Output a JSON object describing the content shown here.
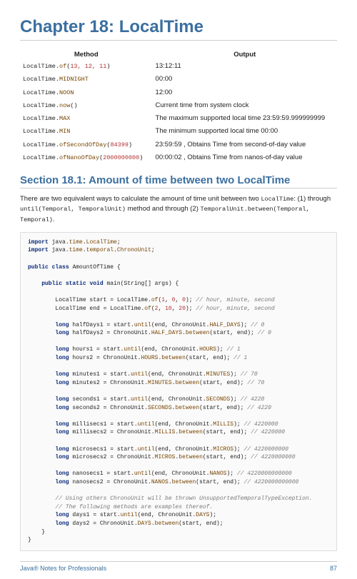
{
  "chapter": {
    "title": "Chapter 18: LocalTime"
  },
  "table": {
    "headers": {
      "col1": "Method",
      "col2": "Output"
    },
    "rows": [
      {
        "m_pre": "LocalTime.",
        "m_fn": "of",
        "m_open": "(",
        "m_args": "13, 12, 11",
        "m_close": ")",
        "out": "13:12:11"
      },
      {
        "m_pre": "LocalTime.",
        "m_fn": "MIDNIGHT",
        "m_open": "",
        "m_args": "",
        "m_close": "",
        "out": "00:00"
      },
      {
        "m_pre": "LocalTime.",
        "m_fn": "NOON",
        "m_open": "",
        "m_args": "",
        "m_close": "",
        "out": "12:00"
      },
      {
        "m_pre": "LocalTime.",
        "m_fn": "now",
        "m_open": "(",
        "m_args": "",
        "m_close": ")",
        "out": "Current time from system clock"
      },
      {
        "m_pre": "LocalTime.",
        "m_fn": "MAX",
        "m_open": "",
        "m_args": "",
        "m_close": "",
        "out": "The maximum supported local time 23:59:59.999999999"
      },
      {
        "m_pre": "LocalTime.",
        "m_fn": "MIN",
        "m_open": "",
        "m_args": "",
        "m_close": "",
        "out": "The minimum supported local time 00:00"
      },
      {
        "m_pre": "LocalTime.",
        "m_fn": "ofSecondOfDay",
        "m_open": "(",
        "m_args": "84399",
        "m_close": ")",
        "out": "23:59:59 , Obtains Time from second-of-day value"
      },
      {
        "m_pre": "LocalTime.",
        "m_fn": "ofNanoOfDay",
        "m_open": "(",
        "m_args": "2000000000",
        "m_close": ")",
        "out": "00:00:02 , Obtains Time from nanos-of-day value"
      }
    ]
  },
  "section": {
    "title": "Section 18.1: Amount of time between two LocalTime"
  },
  "para": {
    "t1": "There are two equivalent ways to calculate the amount of time unit between two ",
    "c1": "LocalTime",
    "t2": ": (1) through ",
    "c2": "until(Temporal, TemporalUnit)",
    "t3": " method and through (2) ",
    "c3": "TemporalUnit.between(Temporal, Temporal)",
    "t4": "."
  },
  "code": {
    "l01a": "import",
    "l01b": " java.",
    "l01c": "time",
    "l01d": ".",
    "l01e": "LocalTime",
    "l01f": ";",
    "l02a": "import",
    "l02b": " java.",
    "l02c": "time",
    "l02d": ".",
    "l02e": "temporal",
    "l02f": ".",
    "l02g": "ChronoUnit",
    "l02h": ";",
    "l03a": "public",
    "l03b": " ",
    "l03c": "class",
    "l03d": " AmountOfTime {",
    "l04a": "    ",
    "l04b": "public",
    "l04c": " ",
    "l04d": "static",
    "l04e": " ",
    "l04f": "void",
    "l04g": " main(String[] args) {",
    "l05a": "        LocalTime start = LocalTime.",
    "l05b": "of",
    "l05c": "(",
    "l05d": "1",
    "l05e": ", ",
    "l05f": "0",
    "l05g": ", ",
    "l05h": "0",
    "l05i": "); ",
    "l05j": "// hour, minute, second",
    "l06a": "        LocalTime end = LocalTime.",
    "l06b": "of",
    "l06c": "(",
    "l06d": "2",
    "l06e": ", ",
    "l06f": "10",
    "l06g": ", ",
    "l06h": "20",
    "l06i": "); ",
    "l06j": "// hour, minute, second",
    "l07a": "        ",
    "l07b": "long",
    "l07c": " halfDays1 = start.",
    "l07d": "until",
    "l07e": "(end, ChronoUnit.",
    "l07f": "HALF_DAYS",
    "l07g": "); ",
    "l07h": "// 0",
    "l08a": "        ",
    "l08b": "long",
    "l08c": " halfDays2 = ChronoUnit.",
    "l08d": "HALF_DAYS",
    "l08e": ".",
    "l08f": "between",
    "l08g": "(start, end); ",
    "l08h": "// 0",
    "l09a": "        ",
    "l09b": "long",
    "l09c": " hours1 = start.",
    "l09d": "until",
    "l09e": "(end, ChronoUnit.",
    "l09f": "HOURS",
    "l09g": "); ",
    "l09h": "// 1",
    "l10a": "        ",
    "l10b": "long",
    "l10c": " hours2 = ChronoUnit.",
    "l10d": "HOURS",
    "l10e": ".",
    "l10f": "between",
    "l10g": "(start, end); ",
    "l10h": "// 1",
    "l11a": "        ",
    "l11b": "long",
    "l11c": " minutes1 = start.",
    "l11d": "until",
    "l11e": "(end, ChronoUnit.",
    "l11f": "MINUTES",
    "l11g": "); ",
    "l11h": "// 70",
    "l12a": "        ",
    "l12b": "long",
    "l12c": " minutes2 = ChronoUnit.",
    "l12d": "MINUTES",
    "l12e": ".",
    "l12f": "between",
    "l12g": "(start, end); ",
    "l12h": "// 70",
    "l13a": "        ",
    "l13b": "long",
    "l13c": " seconds1 = start.",
    "l13d": "until",
    "l13e": "(end, ChronoUnit.",
    "l13f": "SECONDS",
    "l13g": "); ",
    "l13h": "// 4220",
    "l14a": "        ",
    "l14b": "long",
    "l14c": " seconds2 = ChronoUnit.",
    "l14d": "SECONDS",
    "l14e": ".",
    "l14f": "between",
    "l14g": "(start, end); ",
    "l14h": "// 4220",
    "l15a": "        ",
    "l15b": "long",
    "l15c": " millisecs1 = start.",
    "l15d": "until",
    "l15e": "(end, ChronoUnit.",
    "l15f": "MILLIS",
    "l15g": "); ",
    "l15h": "// 4220000",
    "l16a": "        ",
    "l16b": "long",
    "l16c": " millisecs2 = ChronoUnit.",
    "l16d": "MILLIS",
    "l16e": ".",
    "l16f": "between",
    "l16g": "(start, end); ",
    "l16h": "// 4220000",
    "l17a": "        ",
    "l17b": "long",
    "l17c": " microsecs1 = start.",
    "l17d": "until",
    "l17e": "(end, ChronoUnit.",
    "l17f": "MICROS",
    "l17g": "); ",
    "l17h": "// 4220000000",
    "l18a": "        ",
    "l18b": "long",
    "l18c": " microsecs2 = ChronoUnit.",
    "l18d": "MICROS",
    "l18e": ".",
    "l18f": "between",
    "l18g": "(start, end); ",
    "l18h": "// 4220000000",
    "l19a": "        ",
    "l19b": "long",
    "l19c": " nanosecs1 = start.",
    "l19d": "until",
    "l19e": "(end, ChronoUnit.",
    "l19f": "NANOS",
    "l19g": "); ",
    "l19h": "// 4220000000000",
    "l20a": "        ",
    "l20b": "long",
    "l20c": " nanosecs2 = ChronoUnit.",
    "l20d": "NANOS",
    "l20e": ".",
    "l20f": "between",
    "l20g": "(start, end); ",
    "l20h": "// 4220000000000",
    "l21a": "        ",
    "l21b": "// Using others ChronoUnit will be thrown UnsupportedTemporalTypeException.",
    "l22a": "        ",
    "l22b": "// The following methods are examples thereof.",
    "l23a": "        ",
    "l23b": "long",
    "l23c": " days1 = start.",
    "l23d": "until",
    "l23e": "(end, ChronoUnit.",
    "l23f": "DAYS",
    "l23g": ");",
    "l24a": "        ",
    "l24b": "long",
    "l24c": " days2 = ChronoUnit.",
    "l24d": "DAYS",
    "l24e": ".",
    "l24f": "between",
    "l24g": "(start, end);",
    "l25": "    }",
    "l26": "}"
  },
  "footer": {
    "left": "Java® Notes for Professionals",
    "right": "87"
  }
}
